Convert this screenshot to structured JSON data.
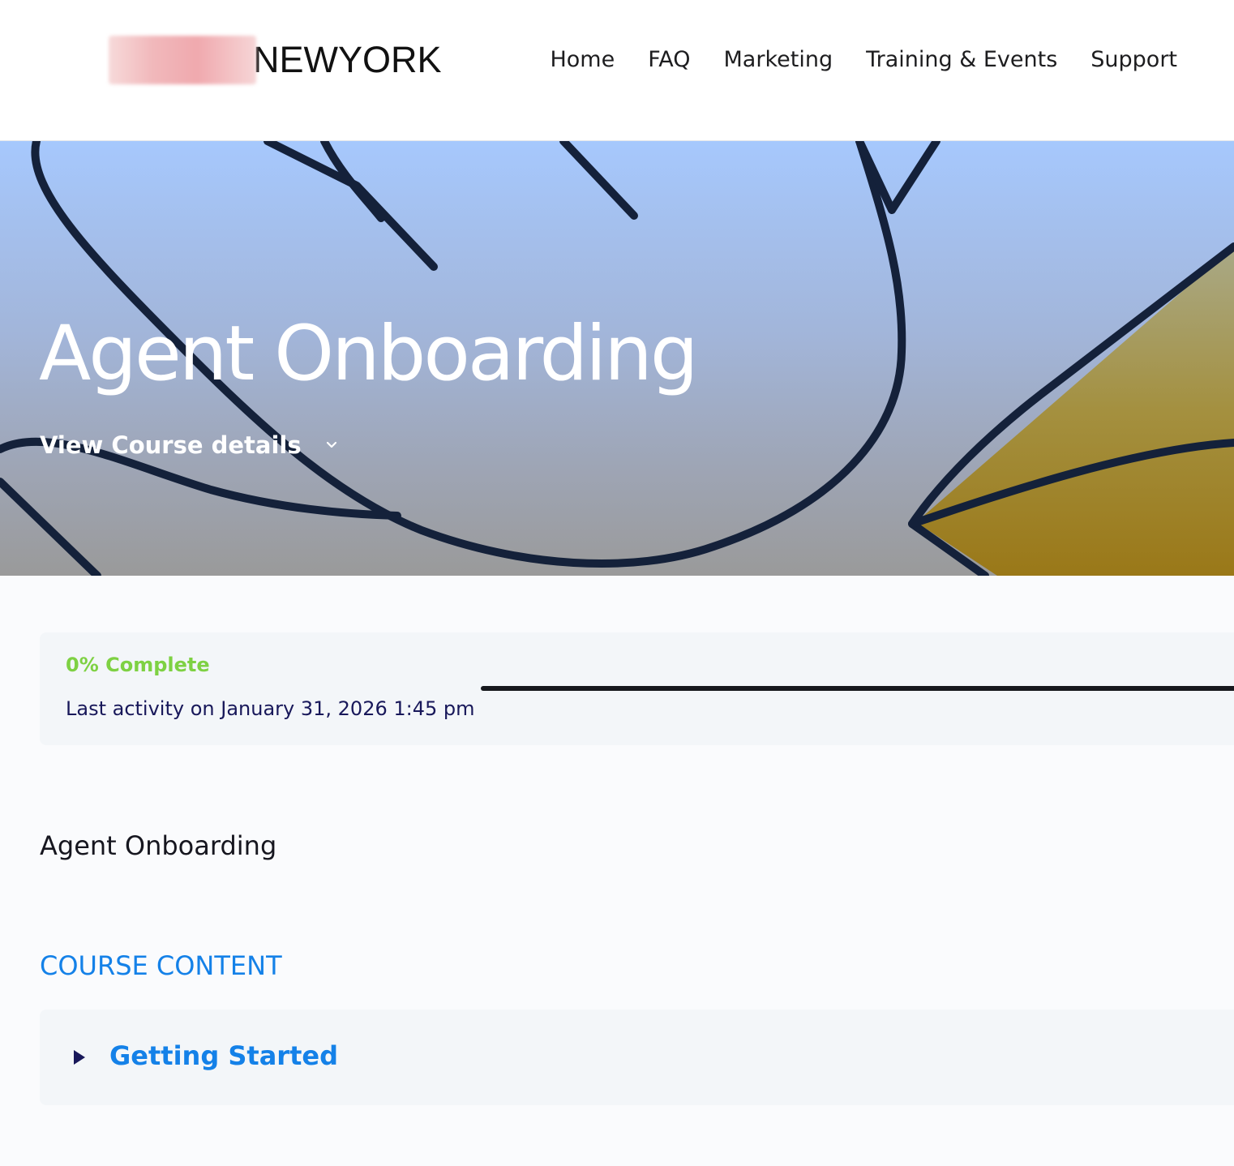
{
  "header": {
    "logo_text": "NEWYORK",
    "nav": [
      {
        "label": "Home"
      },
      {
        "label": "FAQ"
      },
      {
        "label": "Marketing"
      },
      {
        "label": "Training & Events"
      },
      {
        "label": "Support"
      }
    ]
  },
  "hero": {
    "title": "Agent Onboarding",
    "details_label": "View Course details"
  },
  "progress": {
    "percent": 0,
    "percent_label": "0% Complete",
    "last_activity": "Last activity on January 31, 2026 1:45 pm"
  },
  "course": {
    "heading": "Agent Onboarding",
    "content_label": "COURSE CONTENT",
    "sections": [
      {
        "title": "Getting Started"
      }
    ]
  },
  "colors": {
    "accent_blue": "#1481e8",
    "progress_green": "#7ed143",
    "text_navy": "#18185a"
  },
  "icons": {
    "details_toggle": "chevron-down-icon",
    "section_toggle": "triangle-right-icon"
  }
}
